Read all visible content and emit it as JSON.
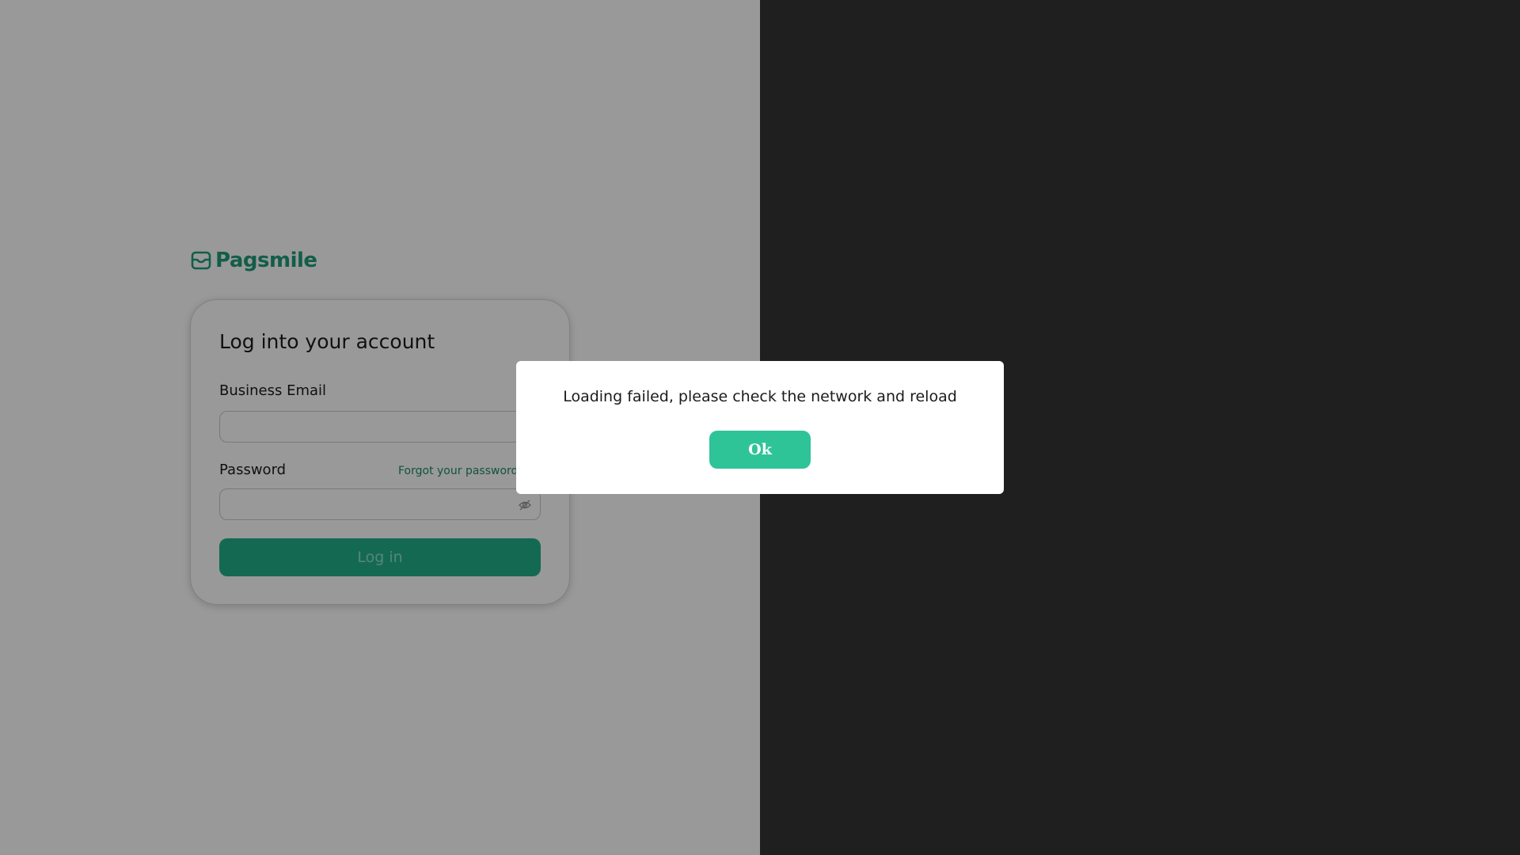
{
  "brand": {
    "name": "Pagsmile",
    "color": "#1f9d78"
  },
  "login": {
    "title": "Log into your account",
    "email_label": "Business Email",
    "email_value": "",
    "password_label": "Password",
    "password_value": "",
    "forgot_link": "Forgot your password?",
    "login_button": "Log in"
  },
  "dialog": {
    "message": "Loading failed, please check the network and reload",
    "ok_button": "Ok",
    "accent_color": "#2ec498"
  },
  "icons": {
    "logo": "inbox-smile-icon",
    "password_toggle": "eye-slash-icon"
  }
}
